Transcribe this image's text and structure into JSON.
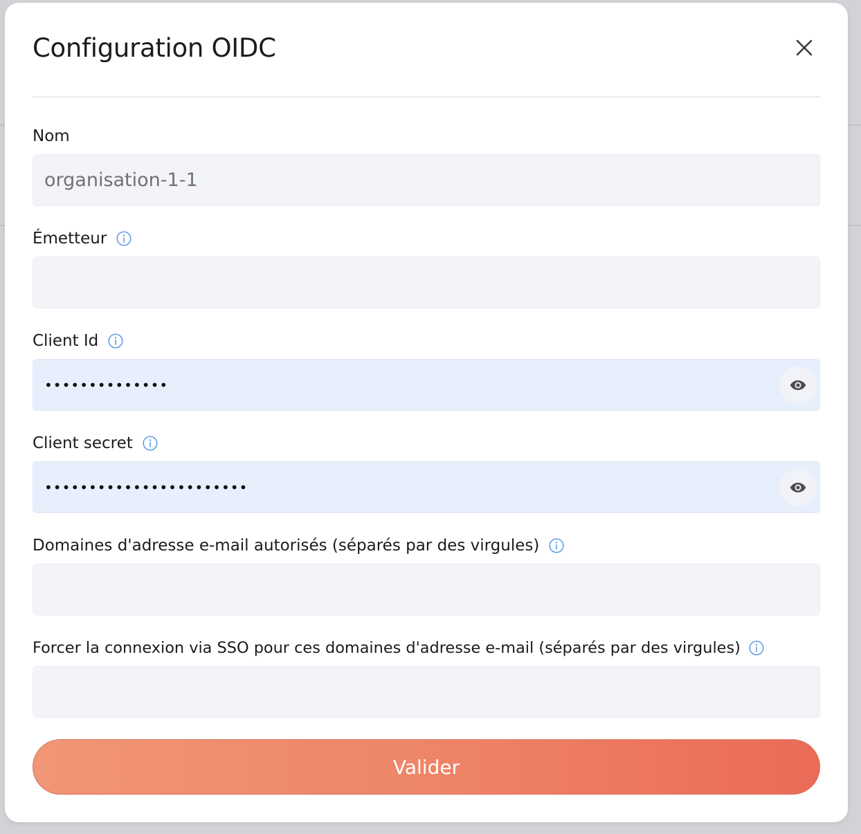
{
  "modal": {
    "title": "Configuration OIDC",
    "close_icon": "close-icon"
  },
  "fields": {
    "name": {
      "label": "Nom",
      "value": "organisation-1-1",
      "placeholder": ""
    },
    "issuer": {
      "label": "Émetteur",
      "value": "",
      "info_icon": "info-icon"
    },
    "client_id": {
      "label": "Client Id",
      "value": "••••••••••••••",
      "info_icon": "info-icon",
      "toggle_icon": "eye-icon"
    },
    "client_secret": {
      "label": "Client secret",
      "value": "•••••••••••••••••••••••",
      "info_icon": "info-icon",
      "toggle_icon": "eye-icon"
    },
    "allowed_domains": {
      "label": "Domaines d'adresse e-mail autorisés (séparés par des virgules)",
      "value": "",
      "info_icon": "info-icon"
    },
    "force_sso_domains": {
      "label": "Forcer la connexion via SSO pour ces domaines d'adresse e-mail (séparés par des virgules)",
      "value": "",
      "info_icon": "info-icon"
    }
  },
  "submit": {
    "label": "Valider"
  },
  "colors": {
    "accent_start": "#f09676",
    "accent_end": "#ea6b58",
    "info_icon": "#5b9be6",
    "input_bg": "#f3f4f8",
    "secret_input_bg": "#e8effc"
  }
}
